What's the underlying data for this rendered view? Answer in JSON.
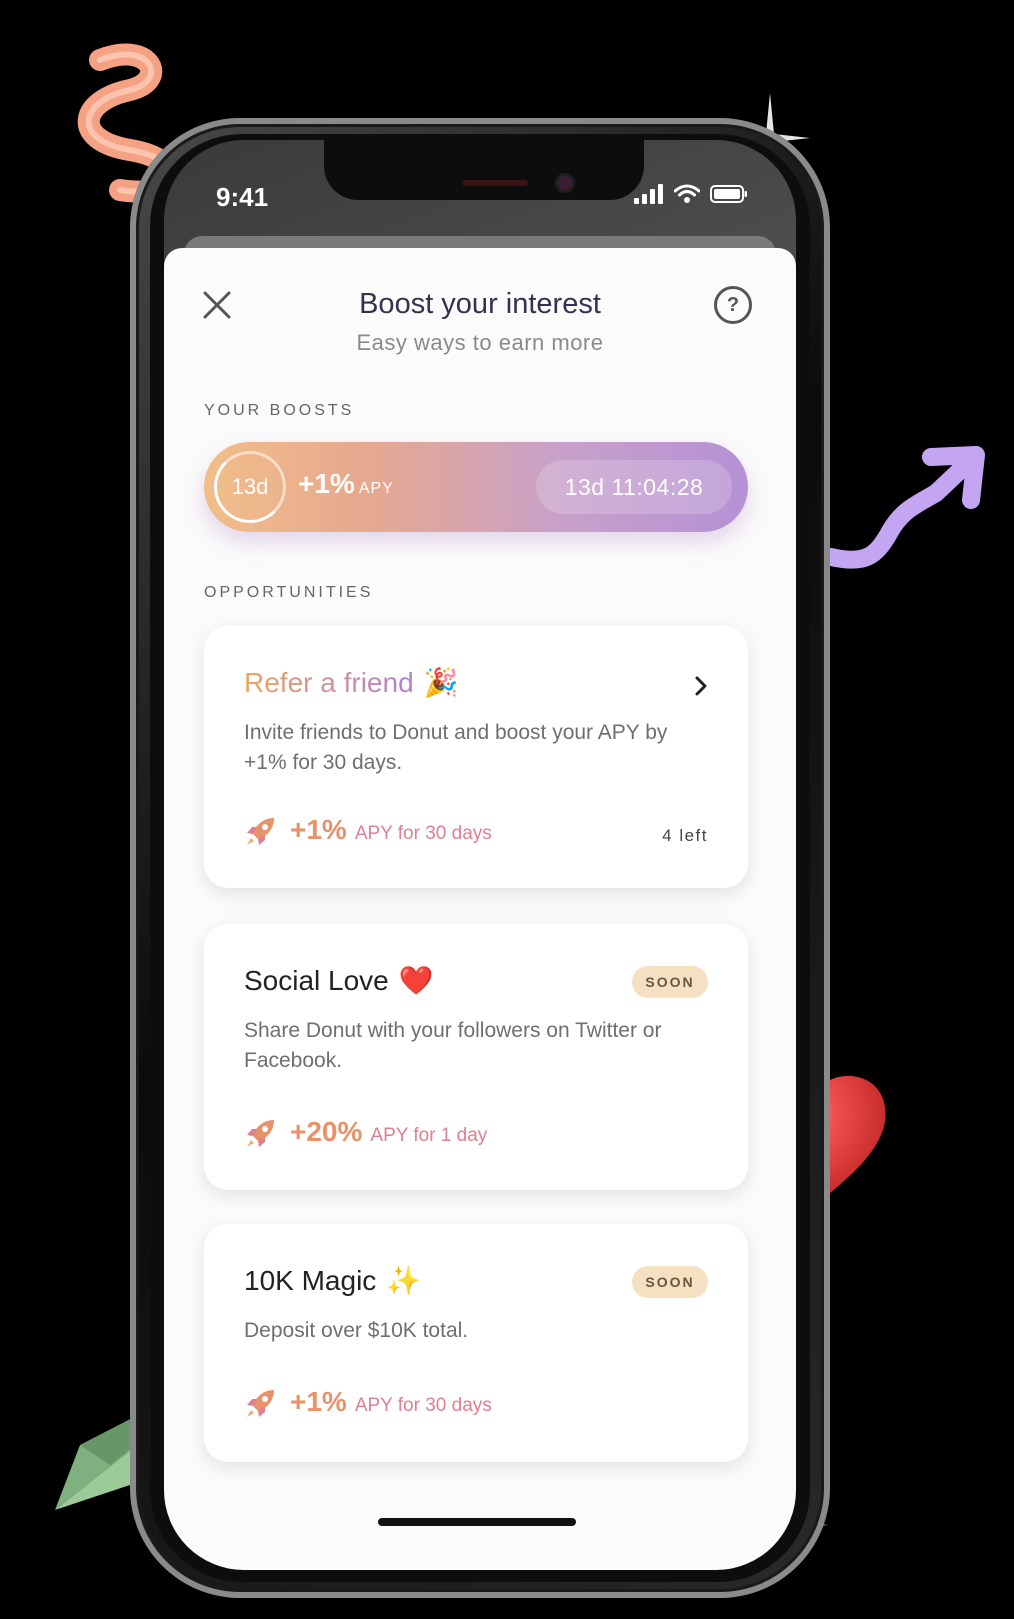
{
  "status_bar": {
    "time": "9:41"
  },
  "header": {
    "title": "Boost your interest",
    "subtitle": "Easy ways to earn more",
    "help_label": "?"
  },
  "your_boosts": {
    "section_label": "YOUR BOOSTS",
    "ring_label": "13d",
    "percent": "+1%",
    "unit": "APY",
    "timer": "13d 11:04:28",
    "colors": {
      "start": "#f1be8a",
      "end": "#b591d6"
    }
  },
  "opportunities": {
    "section_label": "OPPORTUNITIES",
    "items": [
      {
        "title": "Refer a friend",
        "emoji": "🎉",
        "description": "Invite friends to Donut and boost your APY by +1% for 30 days.",
        "reward_percent": "+1%",
        "reward_text": "APY for 30 days",
        "count": "4 left"
      },
      {
        "title": "Social Love",
        "emoji": "❤️",
        "badge": "SOON",
        "description": "Share Donut with your followers on Twitter or Facebook.",
        "reward_percent": "+20%",
        "reward_text": "APY for 1 day"
      },
      {
        "title": "10K Magic",
        "emoji": "✨",
        "badge": "SOON",
        "description": "Deposit over $10K total.",
        "reward_percent": "+1%",
        "reward_text": "APY for 30 days"
      }
    ]
  },
  "colors": {
    "accent_orange": "#e8926a",
    "accent_pink": "#e07f8f",
    "badge_bg": "#f6e0c2"
  }
}
